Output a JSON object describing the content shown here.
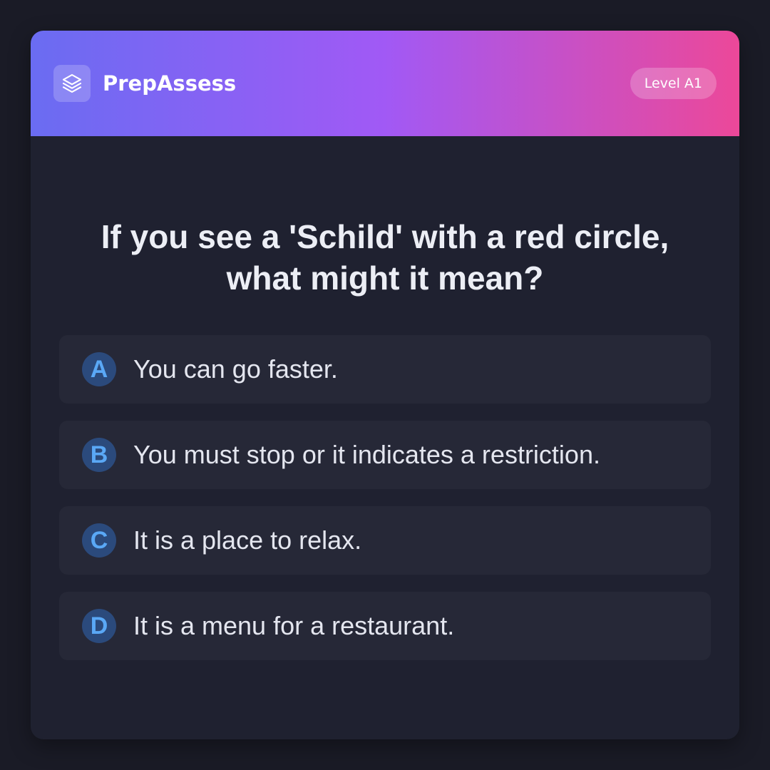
{
  "header": {
    "brand": "PrepAssess",
    "logo_icon": "layers-icon",
    "level_badge": "Level A1",
    "gradient_colors": [
      "#6a6cf2",
      "#a159f5",
      "#ec4899"
    ]
  },
  "question": {
    "text": "If you see a 'Schild' with a red circle, what might it mean?"
  },
  "options": [
    {
      "letter": "A",
      "text": "You can go faster."
    },
    {
      "letter": "B",
      "text": "You must stop or it indicates a restriction."
    },
    {
      "letter": "C",
      "text": "It is a place to relax."
    },
    {
      "letter": "D",
      "text": "It is a menu for a restaurant."
    }
  ],
  "colors": {
    "background": "#1a1b26",
    "card": "#1f2130",
    "option_bg": "#262837",
    "accent": "#5aa8f6"
  }
}
